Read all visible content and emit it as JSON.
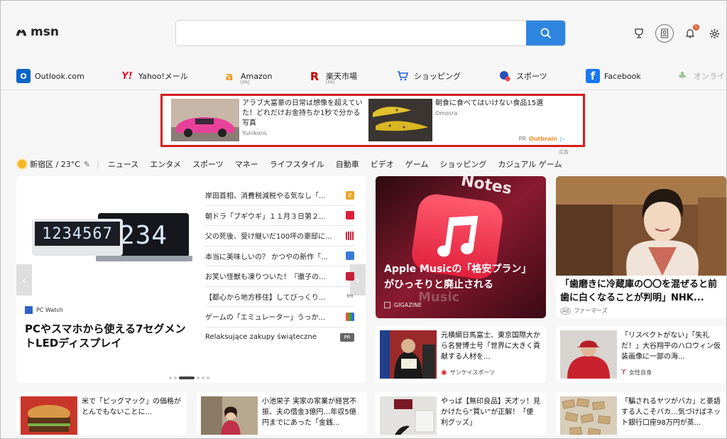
{
  "header": {
    "logo_text": "msn",
    "search_placeholder": "",
    "notification_count": "5"
  },
  "quick_links": [
    {
      "label": "Outlook.com",
      "icon": "outlook-icon",
      "pr": ""
    },
    {
      "label": "Yahoo!メール",
      "icon": "yahoo-icon",
      "pr": ""
    },
    {
      "label": "Amazon",
      "icon": "amazon-icon",
      "pr": "[PR]"
    },
    {
      "label": "楽天市場",
      "icon": "rakuten-icon",
      "pr": "[PR]"
    },
    {
      "label": "ショッピング",
      "icon": "cart-icon",
      "pr": ""
    },
    {
      "label": "スポーツ",
      "icon": "sports-icon",
      "pr": ""
    },
    {
      "label": "Facebook",
      "icon": "facebook-icon",
      "pr": ""
    },
    {
      "label": "オンライ",
      "icon": "games-icon",
      "pr": ""
    }
  ],
  "ad": {
    "item1_title": "アラブ大富豪の日常は想像を超えていた！どれだけお金持ちか1秒で分かる写真",
    "item1_source": "Yunikons",
    "item2_title": "朝食に食べてはいけない食品15選",
    "item2_source": "Omosra",
    "pr": "PR",
    "outbrain": "Outbrain",
    "label": "広告"
  },
  "weather": {
    "location": "新宿区 / 23°C"
  },
  "categories": [
    "ニュース",
    "エンタメ",
    "スポーツ",
    "マネー",
    "ライフスタイル",
    "自動車",
    "ビデオ",
    "ゲーム",
    "ショッピング",
    "カジュアル ゲーム"
  ],
  "main_story": {
    "lcd_left": "1234567",
    "lcd_right": "234",
    "source": "PC Watch",
    "title": "PCやスマホから使える7セグメントLEDディスプレイ"
  },
  "headlines": [
    {
      "text": "岸田首相、消費税減税やる気なし「...",
      "badge": "Z"
    },
    {
      "text": "朝ドラ「ブギウギ」１１月３日第２...",
      "badge": ""
    },
    {
      "text": "父の死後、受け継いだ100坪の豪邸に...",
      "badge": ""
    },
    {
      "text": "本当に美味しいの？ かつやの新作「...",
      "badge": ""
    },
    {
      "text": "お笑い怪獣も凍りついた！『徹子の...",
      "badge": ""
    },
    {
      "text": "【都心から地方移住】してびっくり...",
      "badge": "fm"
    },
    {
      "text": "ゲームの「エミュレーター」うっか...",
      "badge": ""
    },
    {
      "text": "Relaksujące zakupy świąteczne",
      "badge": "PR"
    }
  ],
  "music_story": {
    "image_text": "Notes",
    "image_text2": "Music",
    "title": "Apple Musicの「格安プラン」がひっそりと廃止される",
    "source": "GIGAZINE"
  },
  "kimono_story": {
    "title": "「歯磨きに冷蔵庫の〇〇を混ぜると前歯に白くなることが判明」NHK...",
    "source": "ファーマーズ"
  },
  "small_stories": [
    {
      "title": "元横綱日馬富士、東京国際大から名誉博士号「世界に大きく貢献する人材を...",
      "source": "サンケイスポーツ"
    },
    {
      "title": "「リスペクトがない」「失礼だ！」大谷翔平のハロウィン仮装画像に一部の海...",
      "source": "女性自身"
    }
  ],
  "bottom_stories": [
    {
      "title": "米で「ビッグマック」の価格がとんでもないことに..."
    },
    {
      "title": "小池栄子 実家の家業が経営不振、夫の借金3億円…年収5億円までにあった「金銭..."
    },
    {
      "title": "やっぱ【無印良品】天才ッ！見かけたら“買い”が正解！「便利グッズ」"
    },
    {
      "title": "「騙されるヤツがバカ」と豪語する人こそバカ…気づけばネット銀行口座98万円が蒸..."
    }
  ]
}
